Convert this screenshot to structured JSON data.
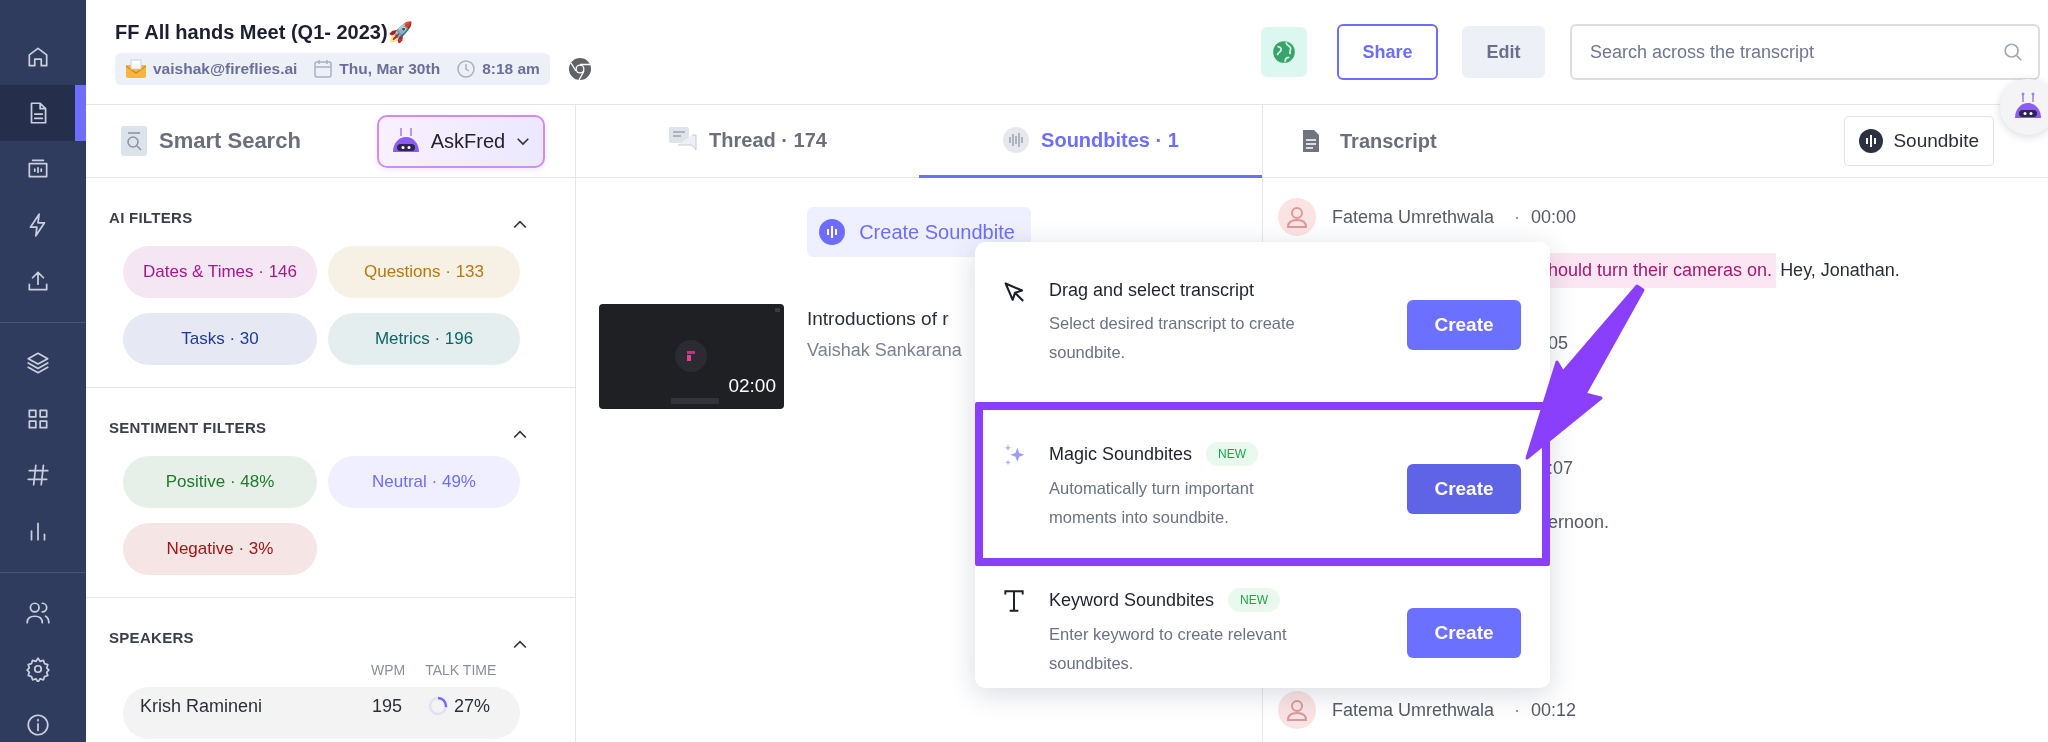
{
  "nav": [
    [
      {
        "kind": "home",
        "selected": false
      },
      {
        "kind": "document",
        "selected": true
      },
      {
        "kind": "meetings",
        "selected": false
      },
      {
        "kind": "bolt",
        "selected": false
      },
      {
        "kind": "upload",
        "selected": false
      }
    ],
    [
      {
        "kind": "layers",
        "selected": false
      },
      {
        "kind": "apps",
        "selected": false
      },
      {
        "kind": "hashtag",
        "selected": false
      },
      {
        "kind": "analytics",
        "selected": false
      }
    ],
    [
      {
        "kind": "people",
        "selected": false
      },
      {
        "kind": "settings",
        "selected": false
      },
      {
        "kind": "info",
        "selected": false
      }
    ]
  ],
  "meeting": {
    "title": "FF All hands Meet (Q1- 2023)🚀",
    "organizer": "vaishak@fireflies.ai",
    "date": "Thu, Mar 30th",
    "time": "8:18 am"
  },
  "actions": {
    "share": "Share",
    "edit": "Edit",
    "search": {
      "placeholder": "Search across the transcript"
    }
  },
  "smart_search": {
    "title": "Smart Search",
    "askfred": "AskFred"
  },
  "filter_sections": [
    {
      "title": "AI FILTERS",
      "expanded": true,
      "chips": [
        {
          "label": "Dates & Times · 146",
          "color": "#a3198f"
        },
        {
          "label": "Questions · 133",
          "color": "#b7790c"
        },
        {
          "label": "Tasks · 30",
          "color": "#1e3a9a"
        },
        {
          "label": "Metrics · 196",
          "color": "#0d6466"
        }
      ]
    },
    {
      "title": "SENTIMENT FILTERS",
      "expanded": true,
      "chips": [
        {
          "label": "Positive · 48%",
          "color": "#1f7a2e"
        },
        {
          "label": "Neutral · 49%",
          "color": "#6d6dff"
        },
        {
          "label": "Negative · 3%",
          "color": "#a31515"
        }
      ]
    }
  ],
  "speakers": {
    "title": "SPEAKERS",
    "expanded": true,
    "columns": [
      "WPM",
      "TALK TIME"
    ],
    "rows": [
      {
        "name": "Krish Ramineni",
        "wpm": "195",
        "talk_time": "27%",
        "level": 0.27
      }
    ]
  },
  "tabs": [
    {
      "kind": "thread",
      "label": "Thread · 174",
      "selected": false
    },
    {
      "kind": "soundbites",
      "label": "Soundbites · 1",
      "selected": true
    }
  ],
  "create_soundbite": "Create Soundbite",
  "soundbites": [
    {
      "title": "Introductions of r",
      "speaker": "Vaishak Sankarana",
      "duration": "02:00"
    }
  ],
  "menu": {
    "items": [
      {
        "kind": "cursor",
        "title": "Drag and select transcript",
        "description": "Select desired transcript to create soundbite.",
        "button": "Create",
        "highlighted": false
      },
      {
        "kind": "magic",
        "title": "Magic Soundbites",
        "badge": "NEW",
        "description": "Automatically turn important moments into soundbite.",
        "button": "Create",
        "highlighted": true
      },
      {
        "kind": "keyword",
        "title": "Keyword Soundbites",
        "badge": "NEW",
        "description": "Enter keyword to create relevant soundbites.",
        "button": "Create",
        "highlighted": false
      }
    ]
  },
  "transcript": {
    "title": "Transcript",
    "soundbite_button": "Soundbite",
    "lines": [
      {
        "kind": "speaker",
        "name": "Fatema Umrethwala",
        "separator": "·",
        "time": "00:00"
      },
      {
        "kind": "text",
        "highlight": "hould turn their cameras on.",
        "text": "Hey, Jonathan."
      },
      {
        "kind": "fragment",
        "text": "05"
      },
      {
        "kind": "fragment",
        "text": ":07"
      },
      {
        "kind": "fragment",
        "text": "ernoon."
      },
      {
        "kind": "speaker",
        "name": "Fatema Umrethwala",
        "separator": "·",
        "time": "00:12"
      }
    ]
  }
}
